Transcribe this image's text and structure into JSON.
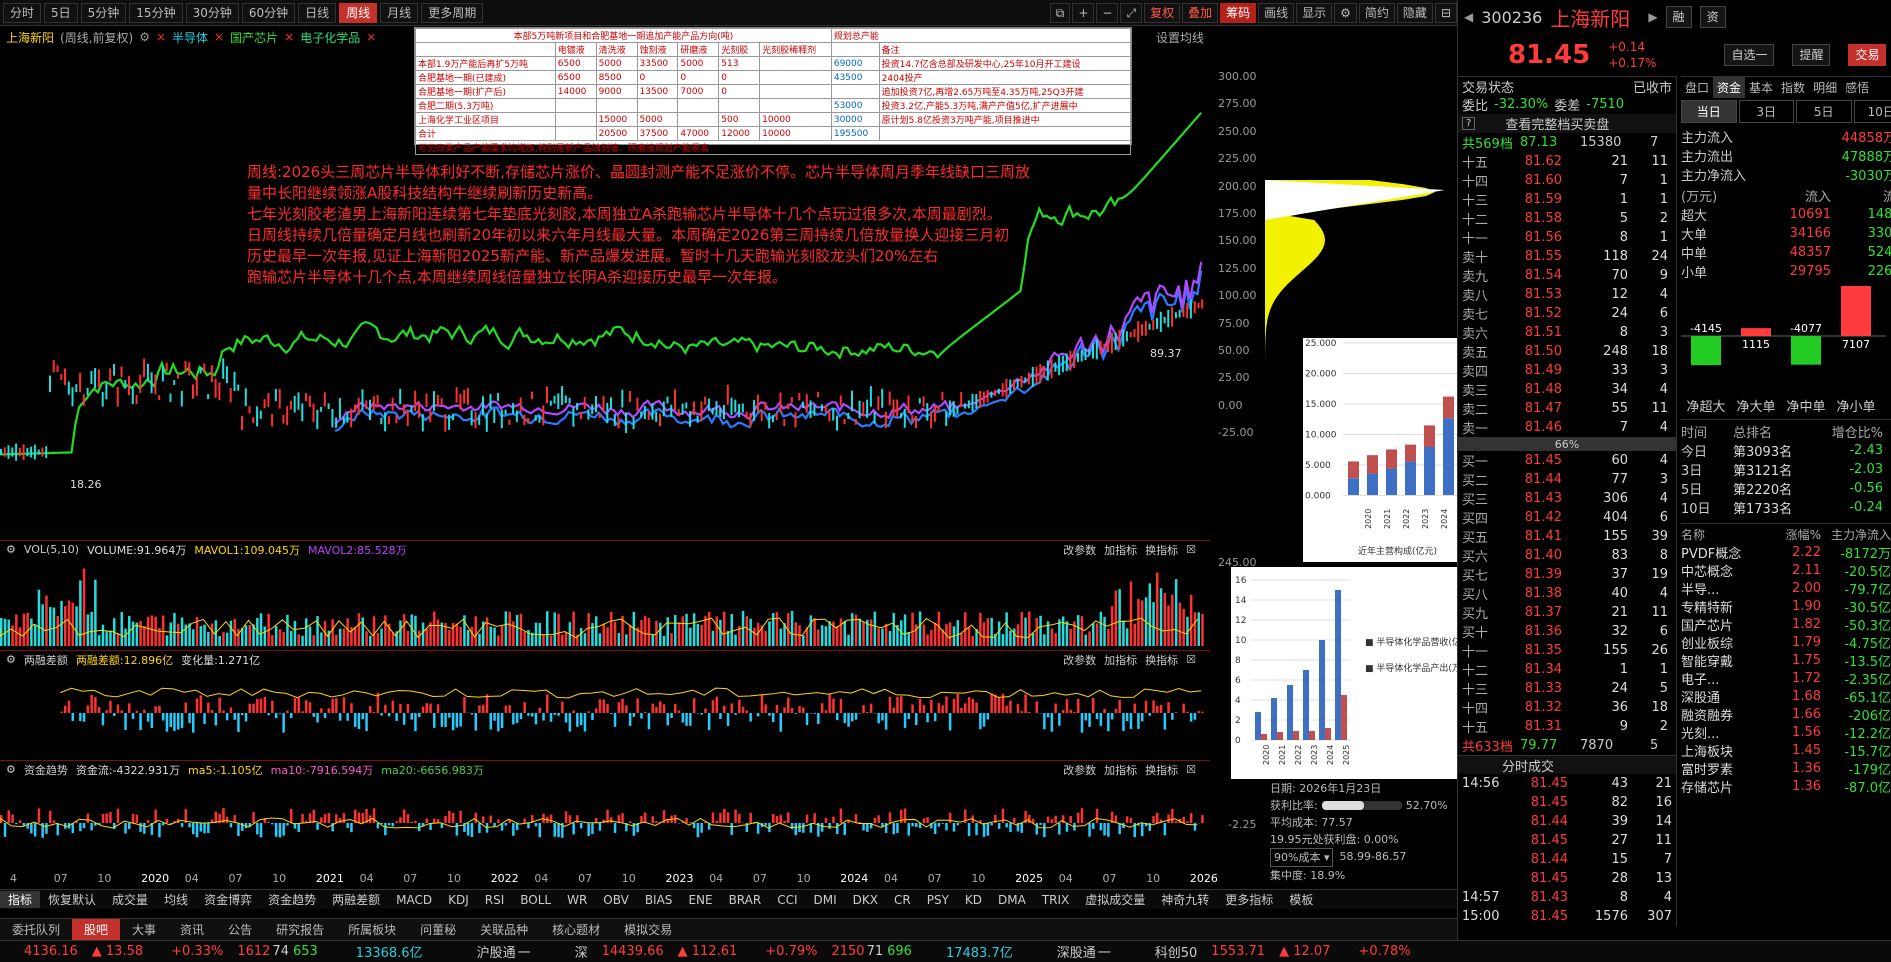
{
  "periods": [
    "分时",
    "5日",
    "5分钟",
    "15分钟",
    "30分钟",
    "60分钟",
    "日线",
    "周线",
    "月线",
    "更多周期"
  ],
  "active_period": "周线",
  "toolbar": {
    "fq": "复权",
    "overlay": "叠加",
    "chip": "筹码",
    "draw": "画线",
    "display": "显示",
    "simple": "简约",
    "hide": "隐藏"
  },
  "info": {
    "name": "上海新阳",
    "mode": "(周线,前复权)",
    "c1": "半导体",
    "c2": "国产芯片",
    "c3": "电子化学品",
    "settings": "设置均线"
  },
  "ann_table": {
    "header": [
      "本部5万吨新项目和合肥基地一期追加产能产品方向(吨)",
      "规划总产能"
    ],
    "cols": [
      "",
      "电镀液",
      "清洗液",
      "蚀刻液",
      "研磨液",
      "光刻胶",
      "光刻胶稀释剂",
      "",
      "备注"
    ],
    "rows": [
      [
        "本部1.9万产能后再扩5万吨",
        "6500",
        "5000",
        "33500",
        "5000",
        "513",
        "",
        "69000",
        "投资14.7亿含总部及研发中心,25年10月开工建设"
      ],
      [
        "合肥基地一期(已建成)",
        "6500",
        "8500",
        "0",
        "0",
        "0",
        "",
        "43500",
        "2404投产"
      ],
      [
        "合肥基地一期(扩产后)",
        "14000",
        "9000",
        "13500",
        "7000",
        "0",
        "",
        "",
        "追加投资7亿,再增2.65万吨至4.35万吨,25Q3开建"
      ],
      [
        "合肥二期(5.3万吨)",
        "",
        "",
        "",
        "",
        "",
        "",
        "53000",
        "投资3.2亿,产能5.3万吨,满产产值5亿,扩产进展中"
      ],
      [
        "上海化学工业区项目",
        "",
        "15000",
        "5000",
        "",
        "500",
        "10000",
        "30000",
        "原计划5.8亿投资3万吨产能,项目推进中"
      ],
      [
        "合计",
        "",
        "20500",
        "37500",
        "47000",
        "12000",
        "10000",
        "195500",
        ""
      ]
    ],
    "footer": "可见四类产品产能需求均增加,特别是新产品蚀刻液、研磨液规划产能很高"
  },
  "annotations": [
    "周线:2026头三周芯片半导体利好不断,存储芯片涨价、晶圆封测产能不足涨价不停。芯片半导体周月季年线缺口三周放",
    "量中长阳继续领涨A股科技结构牛继续刷新历史新高。",
    "七年光刻胶老渣男上海新阳连续第七年垫底光刻胶,本周独立A杀跑输芯片半导体十几个点玩过很多次,本周最剧烈。",
    "日周线持续几倍量确定月线也刷新20年初以来六年月线最大量。本周确定2026第三周持续几倍放量换人迎接三月初",
    "历史最早一次年报,见证上海新阳2025新产能、新产品爆发进展。暂时十几天跑输光刻胶龙头们20%左右",
    "跑输芯片半导体十几个点,本周继续周线倍量独立长阴A杀迎接历史最早一次年报。"
  ],
  "price_axis": [
    "300.00",
    "275.00",
    "250.00",
    "225.00",
    "200.00",
    "175.00",
    "150.00",
    "125.00",
    "100.00",
    "75.00",
    "50.00",
    "25.00",
    "0.00",
    "-25.00"
  ],
  "hi_label": "89.37",
  "lo_label": "18.26",
  "vol_hdr": {
    "name": "VOL(5,10)",
    "vol": "VOLUME:91.964万",
    "ma1": "MAVOL1:109.045万",
    "ma2": "MAVOL2:85.528万",
    "axis": "245.00"
  },
  "rz_hdr": {
    "name": "两融差额",
    "a": "两融差额:12.896亿",
    "b": "变化量:1.271亿"
  },
  "zj_hdr": {
    "name": "资金趋势",
    "a": "资金流:-4322.931万",
    "b": "ma5:-1.105亿",
    "c": "ma10:-7916.594万",
    "d": "ma20:-6656.983万",
    "axis": "-2.25"
  },
  "panel_btns": [
    "改参数",
    "加指标",
    "换指标"
  ],
  "time_axis": [
    "4",
    "07",
    "10",
    "2020",
    "04",
    "07",
    "10",
    "2021",
    "04",
    "07",
    "10",
    "2022",
    "04",
    "07",
    "10",
    "2023",
    "04",
    "07",
    "10",
    "2024",
    "04",
    "07",
    "10",
    "2025",
    "04",
    "07",
    "10",
    "2026"
  ],
  "chip_info": {
    "date": "日期: 2026年1月23日",
    "profit": "获利比率:",
    "profit_v": "52.70%",
    "avg": "平均成本: 77.57",
    "cost90": "19.95元处获利盘: 0.00%",
    "sel": "90%成本",
    "range": "58.99-86.57",
    "conc": "集中度: 18.9%"
  },
  "inset1": {
    "title": "近年主营构成(亿元)",
    "ylabels": [
      "25.000",
      "20.000",
      "15.000",
      "10.000",
      "5.000",
      "0.000"
    ],
    "years": [
      "2020",
      "2021",
      "2022",
      "2023",
      "2024",
      "2025"
    ],
    "legend": [
      "涂料",
      "半导体"
    ],
    "semi": [
      3.5,
      4.5,
      5.5,
      7,
      10,
      16
    ],
    "coat": [
      3.5,
      3.8,
      4,
      3.5,
      4.5,
      4.5
    ]
  },
  "inset2": {
    "ylabels": [
      "16",
      "14",
      "12",
      "10",
      "8",
      "6",
      "4",
      "2",
      "0"
    ],
    "years": [
      "2020",
      "2021",
      "2022",
      "2023",
      "2024",
      "2025"
    ],
    "legend": [
      "半导体化学品营收(亿元)",
      "半导体化学品产出(万吨)"
    ],
    "rev": [
      2.8,
      4.2,
      5.5,
      7,
      10,
      15
    ],
    "out": [
      0.6,
      0.8,
      0.9,
      0.9,
      1.2,
      4.5
    ]
  },
  "indicators": [
    "指标",
    "恢复默认",
    "成交量",
    "均线",
    "资金博弈",
    "资金趋势",
    "两融差额",
    "MACD",
    "KDJ",
    "RSI",
    "BOLL",
    "WR",
    "OBV",
    "BIAS",
    "ENE",
    "BRAR",
    "CCI",
    "DMI",
    "DKX",
    "CR",
    "PSY",
    "KD",
    "DMA",
    "TRIX",
    "虚拟成交量",
    "神奇九转",
    "更多指标",
    "模板"
  ],
  "bottom_tabs": [
    "委托队列",
    "股吧",
    "大事",
    "资讯",
    "公告",
    "研究报告",
    "所属板块",
    "问董秘",
    "关联品种",
    "核心题材",
    "模拟交易"
  ],
  "stock": {
    "code": "300236",
    "name": "上海新阳",
    "price": "81.45",
    "chg": "+0.14",
    "pct": "+0.17%",
    "b1": "融",
    "b2": "资",
    "btn1": "自选一",
    "btn2": "提醒",
    "btn3": "交易"
  },
  "trade_state": {
    "label": "交易状态",
    "value": "已收市",
    "wb": "委比",
    "wb_v": "-32.30%",
    "wc": "委差",
    "wc_v": "-7510"
  },
  "book_btn": "查看完整档买卖盘",
  "book_total": {
    "label": "共569档",
    "price": "87.13",
    "vol": "15380",
    "n": "7"
  },
  "asks": [
    [
      "十五",
      "81.62",
      "21",
      "11"
    ],
    [
      "十四",
      "81.60",
      "7",
      "1"
    ],
    [
      "十三",
      "81.59",
      "1",
      "1"
    ],
    [
      "十二",
      "81.58",
      "5",
      "2"
    ],
    [
      "十一",
      "81.56",
      "8",
      "1"
    ],
    [
      "卖十",
      "81.55",
      "118",
      "24"
    ],
    [
      "卖九",
      "81.54",
      "70",
      "9"
    ],
    [
      "卖八",
      "81.53",
      "12",
      "4"
    ],
    [
      "卖七",
      "81.52",
      "24",
      "6"
    ],
    [
      "卖六",
      "81.51",
      "8",
      "3"
    ],
    [
      "卖五",
      "81.50",
      "248",
      "18"
    ],
    [
      "卖四",
      "81.49",
      "33",
      "3"
    ],
    [
      "卖三",
      "81.48",
      "34",
      "4"
    ],
    [
      "卖二",
      "81.47",
      "55",
      "11"
    ],
    [
      "卖一",
      "81.46",
      "7",
      "4"
    ]
  ],
  "mid_pct": "66%",
  "bids": [
    [
      "买一",
      "81.45",
      "60",
      "4"
    ],
    [
      "买二",
      "81.44",
      "77",
      "3"
    ],
    [
      "买三",
      "81.43",
      "306",
      "4"
    ],
    [
      "买四",
      "81.42",
      "404",
      "6"
    ],
    [
      "买五",
      "81.41",
      "155",
      "39"
    ],
    [
      "买六",
      "81.40",
      "83",
      "8"
    ],
    [
      "买七",
      "81.39",
      "37",
      "19"
    ],
    [
      "买八",
      "81.38",
      "40",
      "4"
    ],
    [
      "买九",
      "81.37",
      "21",
      "11"
    ],
    [
      "买十",
      "81.36",
      "32",
      "6"
    ],
    [
      "十一",
      "81.35",
      "155",
      "26"
    ],
    [
      "十二",
      "81.34",
      "1",
      "1"
    ],
    [
      "十三",
      "81.33",
      "24",
      "5"
    ],
    [
      "十四",
      "81.32",
      "36",
      "18"
    ],
    [
      "十五",
      "81.31",
      "9",
      "2"
    ]
  ],
  "bid_total": {
    "label": "共633档",
    "price": "79.77",
    "vol": "7870",
    "n": "5"
  },
  "trades_title": "分时成交",
  "trades": [
    [
      "14:56",
      "81.45",
      "43",
      "21"
    ],
    [
      "",
      "81.45",
      "82",
      "16"
    ],
    [
      "",
      "81.44",
      "39",
      "14"
    ],
    [
      "",
      "81.45",
      "27",
      "11"
    ],
    [
      "",
      "81.44",
      "15",
      "7"
    ],
    [
      "",
      "81.45",
      "28",
      "13"
    ],
    [
      "14:57",
      "81.43",
      "8",
      "4"
    ],
    [
      "15:00",
      "81.45",
      "1576",
      "307"
    ]
  ],
  "tabs_right": [
    "盘口",
    "资金",
    "基本",
    "指数",
    "明细",
    "感悟"
  ],
  "active_rtab": "资金",
  "days": [
    "当日",
    "3日",
    "5日",
    "10日"
  ],
  "flows": [
    [
      "主力流入",
      "44858万元"
    ],
    [
      "主力流出",
      "47888万元"
    ],
    [
      "主力净流入",
      "-3030万元"
    ]
  ],
  "flow_table": {
    "unit": "(万元)",
    "in": "流入",
    "out": "流出",
    "rows": [
      [
        "超大",
        "10691",
        "14836"
      ],
      [
        "大单",
        "34166",
        "33051"
      ],
      [
        "中单",
        "48357",
        "52434"
      ],
      [
        "小单",
        "29795",
        "22688"
      ]
    ]
  },
  "net_bars": [
    {
      "label": "净超大",
      "value": "-4145"
    },
    {
      "label": "净大单",
      "value": "1115"
    },
    {
      "label": "净中单",
      "value": "-4077"
    },
    {
      "label": "净小单",
      "value": "7107"
    }
  ],
  "rank_hdr": [
    "时间",
    "总排名",
    "增仓比%"
  ],
  "ranks": [
    [
      "今日",
      "第3093名",
      "-2.43"
    ],
    [
      "3日",
      "第3121名",
      "-2.03"
    ],
    [
      "5日",
      "第2220名",
      "-0.56"
    ],
    [
      "10日",
      "第1733名",
      "-0.24"
    ]
  ],
  "sector_hdr": [
    "名称",
    "涨幅%",
    "主力净流入"
  ],
  "sectors": [
    [
      "PVDF概念",
      "2.22",
      "-8172万"
    ],
    [
      "中芯概念",
      "2.11",
      "-20.5亿"
    ],
    [
      "半导...",
      "2.00",
      "-79.7亿"
    ],
    [
      "专精特新",
      "1.90",
      "-30.5亿"
    ],
    [
      "国产芯片",
      "1.82",
      "-50.3亿"
    ],
    [
      "创业板综",
      "1.79",
      "-4.75亿"
    ],
    [
      "智能穿戴",
      "1.75",
      "-13.5亿"
    ],
    [
      "电子...",
      "1.72",
      "-2.35亿"
    ],
    [
      "深股通",
      "1.68",
      "-65.1亿"
    ],
    [
      "融资融券",
      "1.66",
      "-206亿"
    ],
    [
      "光刻...",
      "1.56",
      "-12.2亿"
    ],
    [
      "上海板块",
      "1.45",
      "-15.7亿"
    ],
    [
      "富时罗素",
      "1.36",
      "-179亿"
    ],
    [
      "存储芯片",
      "1.36",
      "-87.0亿"
    ]
  ],
  "statusbar": {
    "sh": "4136.16",
    "sh_c": "13.58",
    "sh_p": "+0.33%",
    "sh_u": "1612",
    "sh_f": "74",
    "sh_d": "653",
    "sh_amt": "13368.6亿",
    "hgt": "沪股通",
    "hgt_v": "一",
    "sz": "深",
    "sz_i": "14439.66",
    "sz_c": "112.61",
    "sz_p": "+0.79%",
    "sz_u": "2150",
    "sz_f": "71",
    "sz_d": "696",
    "sz_amt": "17483.7亿",
    "sgt": "深股通",
    "sgt_v": "一",
    "kc": "科创50",
    "kc_i": "1553.71",
    "kc_c": "12.07",
    "kc_p": "+0.78%"
  },
  "colors": {
    "up": "#ff3b3b",
    "down": "#33e033",
    "green_line": "#22cc22",
    "purple": "#b048ff",
    "blue": "#2a7bff"
  }
}
